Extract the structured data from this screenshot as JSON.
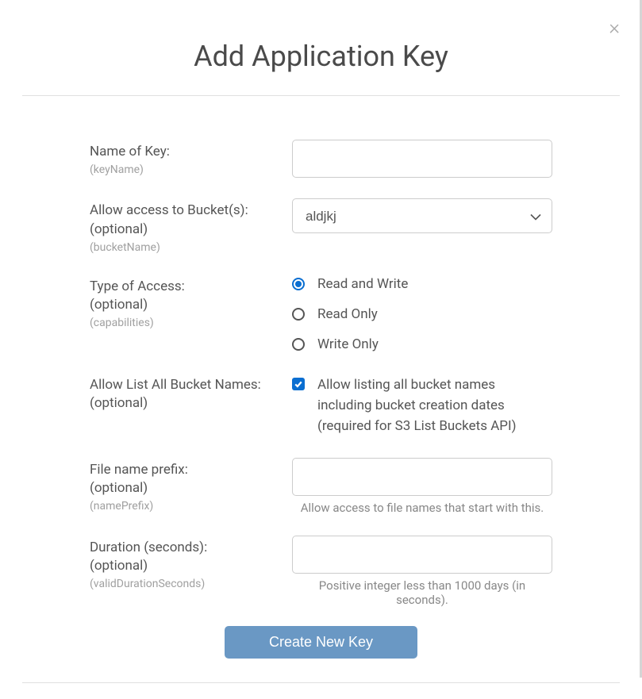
{
  "modal": {
    "title": "Add Application Key"
  },
  "fields": {
    "name": {
      "label": "Name of Key:",
      "sub": "(keyName)",
      "value": ""
    },
    "bucket": {
      "label": "Allow access to Bucket(s):",
      "optional": "(optional)",
      "sub": "(bucketName)",
      "selected": "aldjkj"
    },
    "access": {
      "label": "Type of Access:",
      "optional": "(optional)",
      "sub": "(capabilities)",
      "options": {
        "rw": "Read and Write",
        "ro": "Read Only",
        "wo": "Write Only"
      }
    },
    "listAll": {
      "label": "Allow List All Bucket Names:",
      "optional": "(optional)",
      "checkboxText": "Allow listing all bucket names including bucket creation dates (required for S3 List Buckets API)"
    },
    "prefix": {
      "label": "File name prefix:",
      "optional": "(optional)",
      "sub": "(namePrefix)",
      "value": "",
      "helper": "Allow access to file names that start with this."
    },
    "duration": {
      "label": "Duration (seconds):",
      "optional": "(optional)",
      "sub": "(validDurationSeconds)",
      "value": "",
      "helper": "Positive integer less than 1000 days (in seconds)."
    }
  },
  "submit": {
    "label": "Create New Key"
  }
}
